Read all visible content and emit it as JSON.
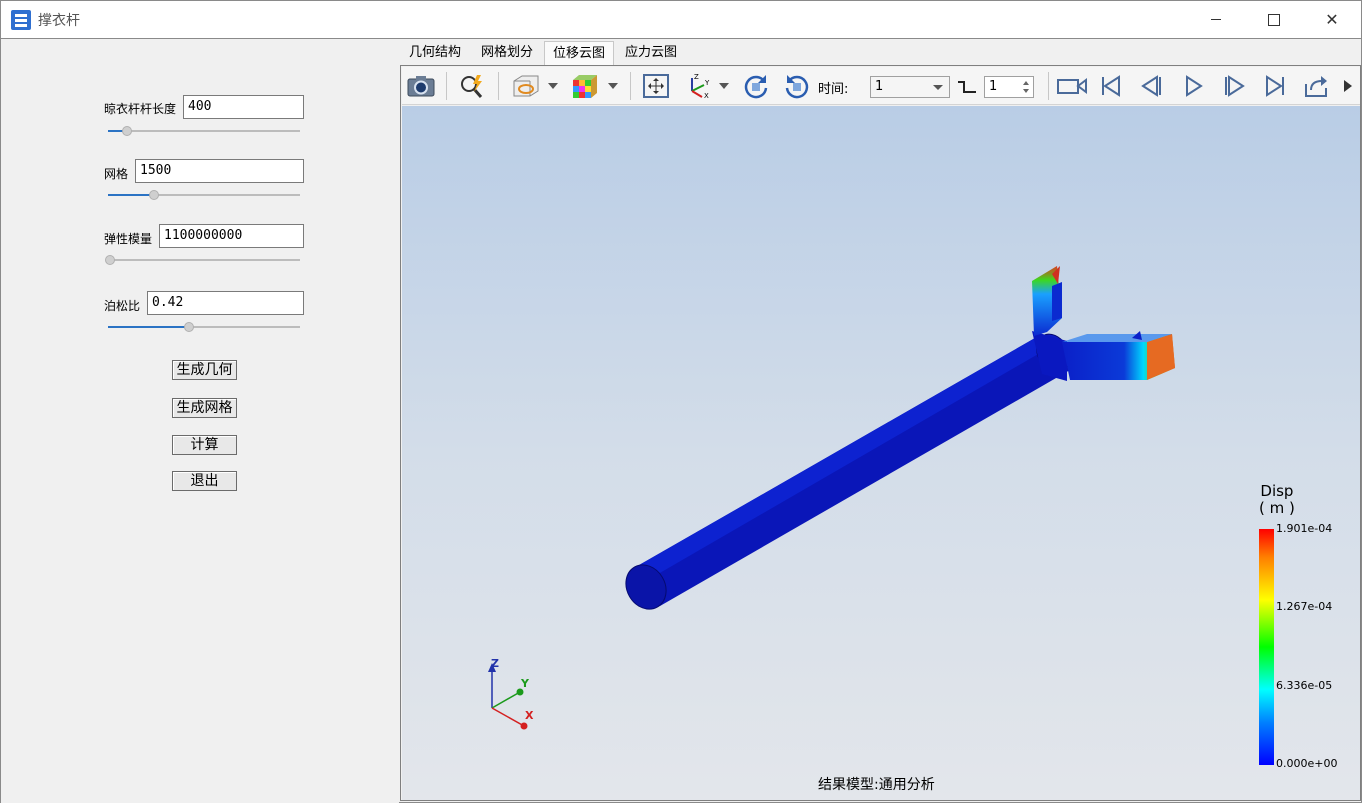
{
  "window": {
    "title": "撑衣杆"
  },
  "params": {
    "length": {
      "label": "晾衣杆杆长度",
      "value": "400",
      "slider": 0.1
    },
    "mesh": {
      "label": "网格",
      "value": "1500",
      "slider": 0.25
    },
    "modulus": {
      "label": "弹性模量",
      "value": "1100000000",
      "slider": 0.0
    },
    "poisson": {
      "label": "泊松比",
      "value": "0.42",
      "slider": 0.42
    }
  },
  "buttons": {
    "gen_geom": "生成几何",
    "gen_mesh": "生成网格",
    "calc": "计算",
    "exit": "退出"
  },
  "tabs": [
    {
      "label": "几何结构",
      "active": false
    },
    {
      "label": "网格划分",
      "active": false
    },
    {
      "label": "位移云图",
      "active": true
    },
    {
      "label": "应力云图",
      "active": false
    }
  ],
  "toolbar": {
    "time_label": "时间:",
    "time_value": "1",
    "step_value": "1"
  },
  "legend": {
    "title": "Disp",
    "unit": "( m )",
    "ticks": [
      "1.901e-04",
      "1.267e-04",
      "6.336e-05",
      "0.000e+00"
    ]
  },
  "axes": {
    "x": "X",
    "y": "Y",
    "z": "Z"
  },
  "footer": "结果模型:通用分析"
}
